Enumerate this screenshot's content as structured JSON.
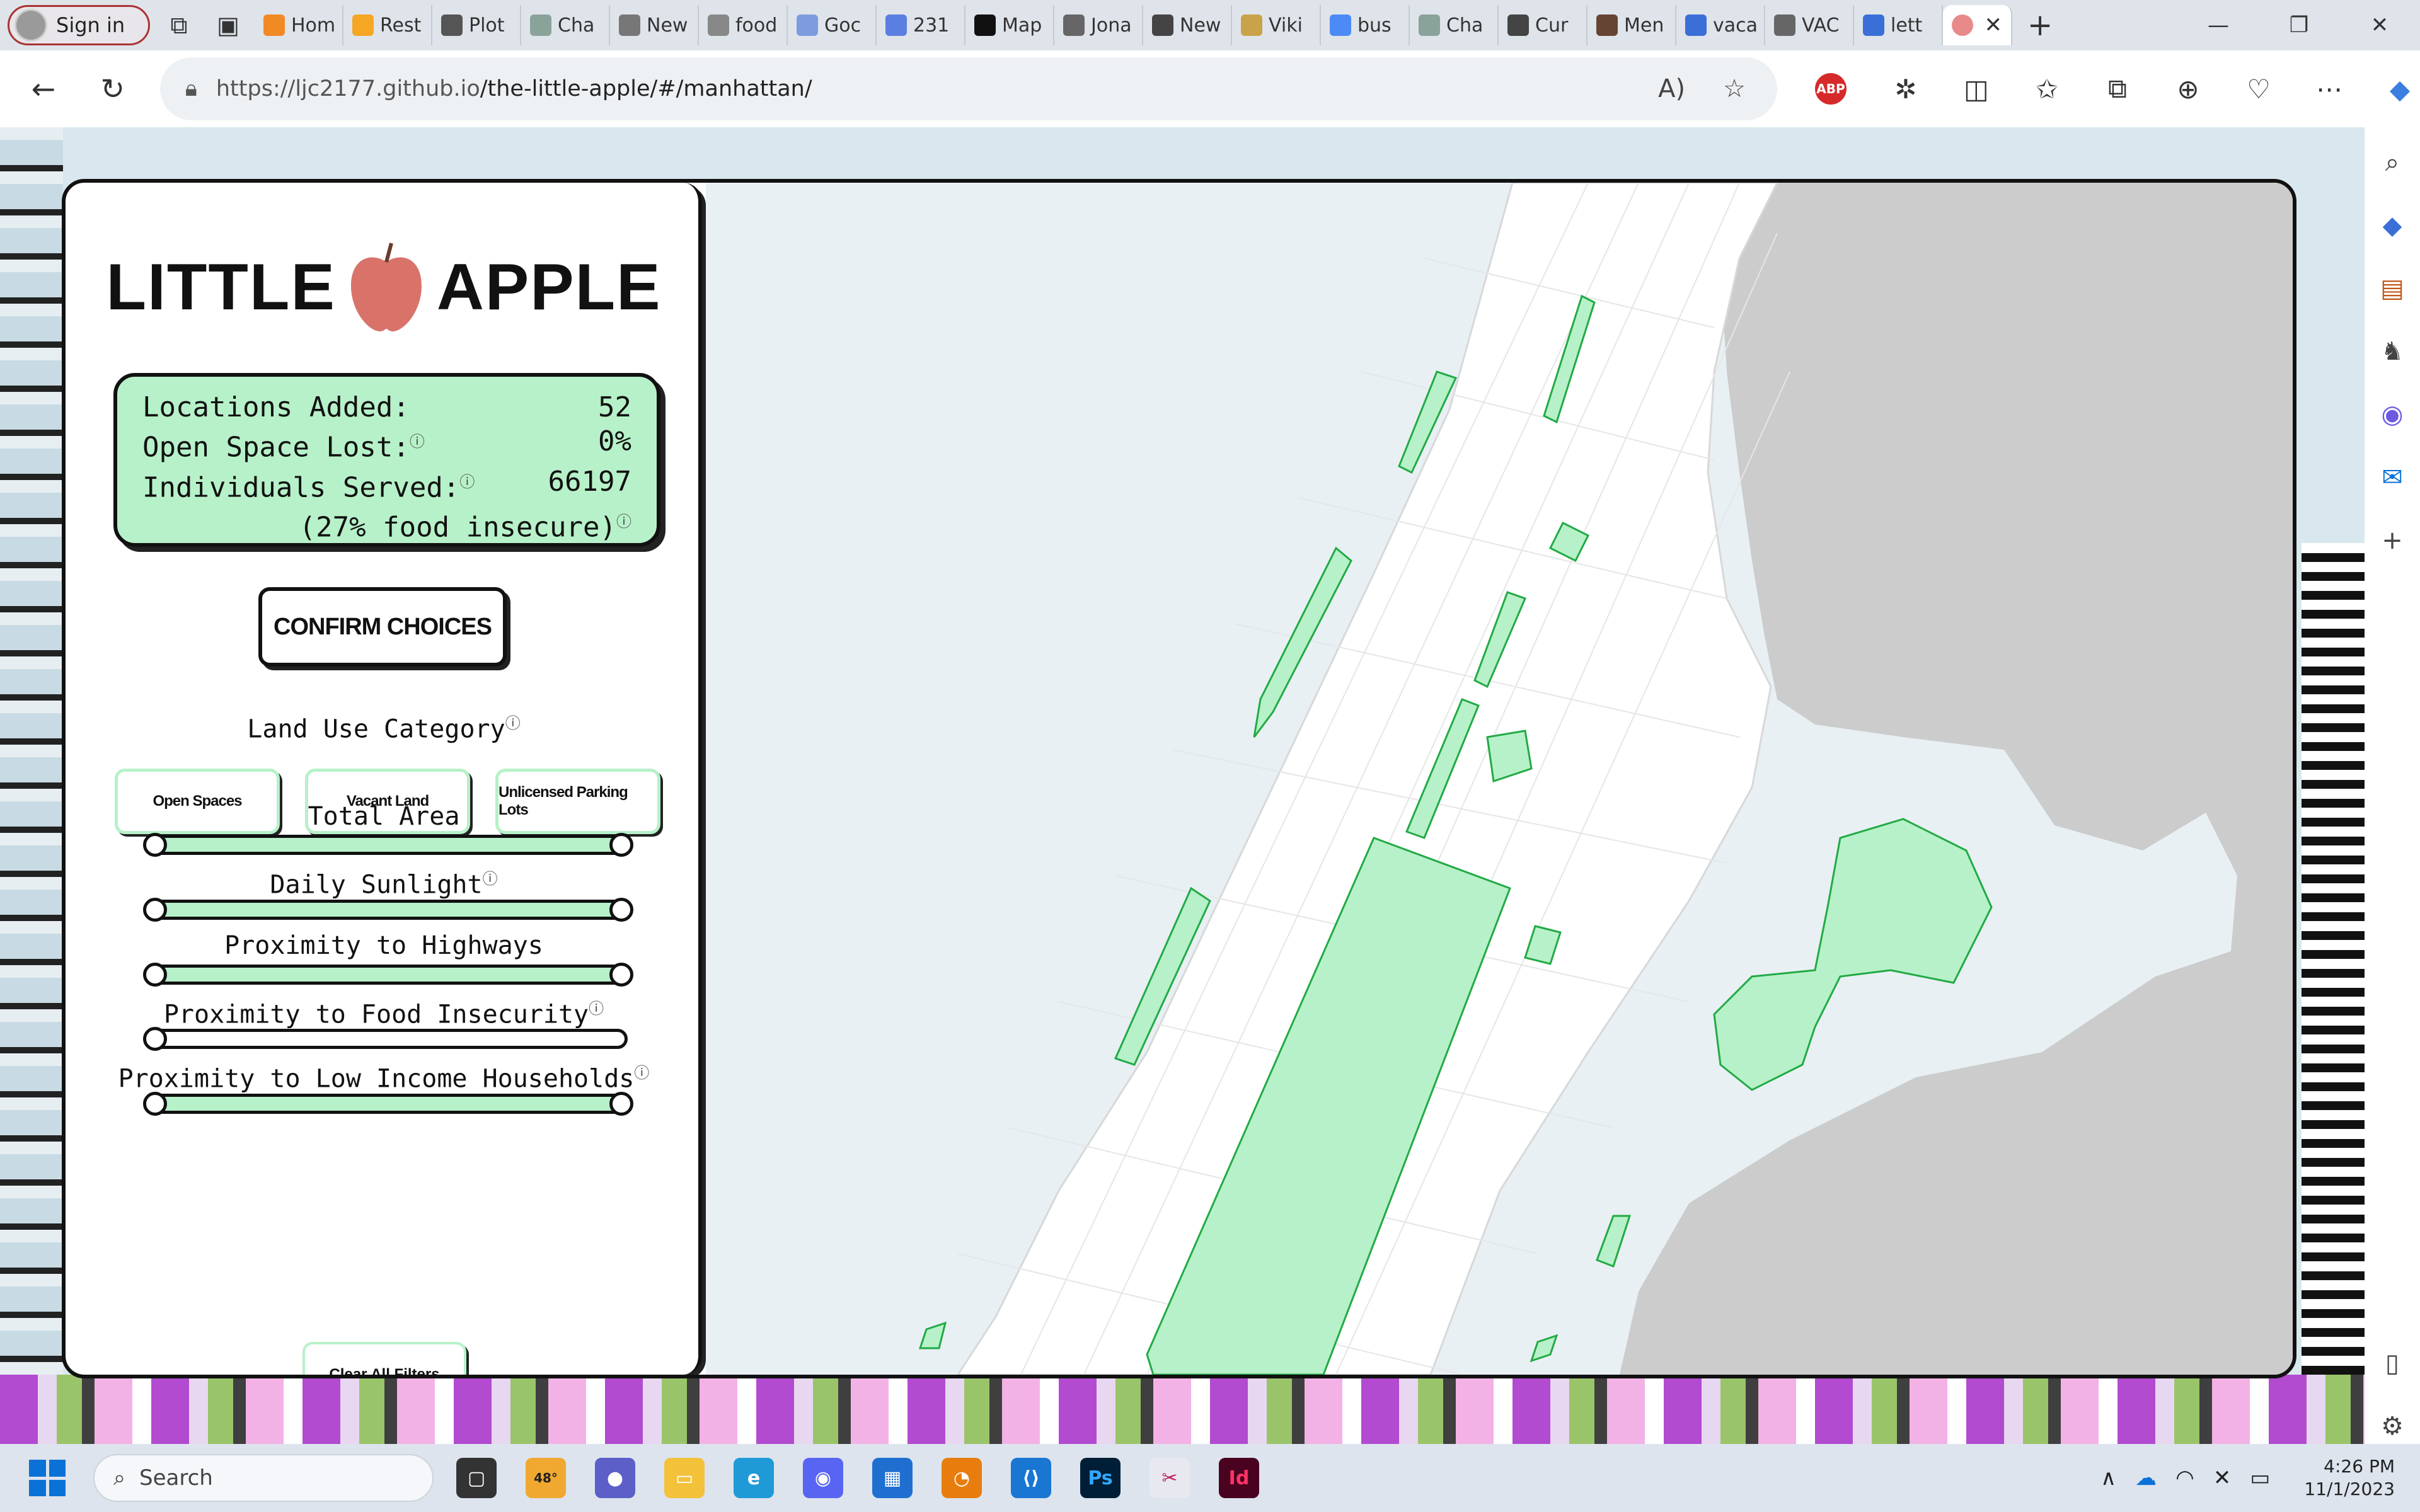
{
  "browser": {
    "profile_label": "Sign in",
    "tabs": [
      {
        "label": "Hom",
        "color": "#f28a24"
      },
      {
        "label": "Rest",
        "color": "#f5a623"
      },
      {
        "label": "Plot",
        "color": "#555555"
      },
      {
        "label": "Cha",
        "color": "#8aa39a"
      },
      {
        "label": "New",
        "color": "#777777"
      },
      {
        "label": "food",
        "color": "#888888"
      },
      {
        "label": "Goc",
        "color": "#7f9be0"
      },
      {
        "label": "231",
        "color": "#5b7fe0"
      },
      {
        "label": "Map",
        "color": "#111111"
      },
      {
        "label": "Jona",
        "color": "#666666"
      },
      {
        "label": "New",
        "color": "#444444"
      },
      {
        "label": "Viki",
        "color": "#c9a34a"
      },
      {
        "label": "bus",
        "color": "#4c8bf5"
      },
      {
        "label": "Cha",
        "color": "#8aa39a"
      },
      {
        "label": "Cur",
        "color": "#444444"
      },
      {
        "label": "Men",
        "color": "#664433"
      },
      {
        "label": "vaca",
        "color": "#3a6fd8"
      },
      {
        "label": "VAC",
        "color": "#666666"
      },
      {
        "label": "lett",
        "color": "#3a6fd8"
      }
    ],
    "active_tab_color": "#e88a8a",
    "url_host": "https://ljc2177.github.io",
    "url_path": "/the-little-apple/#/manhattan/",
    "abp_label": "ABP"
  },
  "app": {
    "logo_left": "LITTLE",
    "logo_right": "APPLE",
    "stats": {
      "locations_label": "Locations Added:",
      "locations_value": "52",
      "open_space_label": "Open Space Lost:",
      "open_space_value": "0%",
      "individuals_label": "Individuals Served:",
      "individuals_value": "66197",
      "insecure_note": "(27% food insecure)"
    },
    "confirm_label": "CONFIRM CHOICES",
    "land_use_label": "Land Use Category",
    "categories": [
      "Open Spaces",
      "Vacant Land",
      "Unlicensed Parking Lots"
    ],
    "filters": [
      {
        "label": "Total Area",
        "range": [
          0,
          1
        ],
        "has_info": false
      },
      {
        "label": "Daily Sunlight",
        "range": [
          0,
          1
        ],
        "has_info": true
      },
      {
        "label": "Proximity to Highways",
        "range": [
          0,
          1
        ],
        "has_info": false
      },
      {
        "label": "Proximity to Food Insecurity",
        "range": [
          0,
          0
        ],
        "has_info": true
      },
      {
        "label": "Proximity to Low Income Households",
        "range": [
          0,
          1
        ],
        "has_info": true
      }
    ],
    "clear_label": "Clear All Filters",
    "info_glyph": "ⓘ",
    "colors": {
      "accent_green": "#b7f1c9",
      "apple_red": "#d9736a",
      "map_water": "#e8f0f4",
      "map_land_gray": "#cccccc"
    }
  },
  "taskbar": {
    "search_placeholder": "Search",
    "weather": "48°",
    "time": "4:26 PM",
    "date": "11/1/2023"
  }
}
